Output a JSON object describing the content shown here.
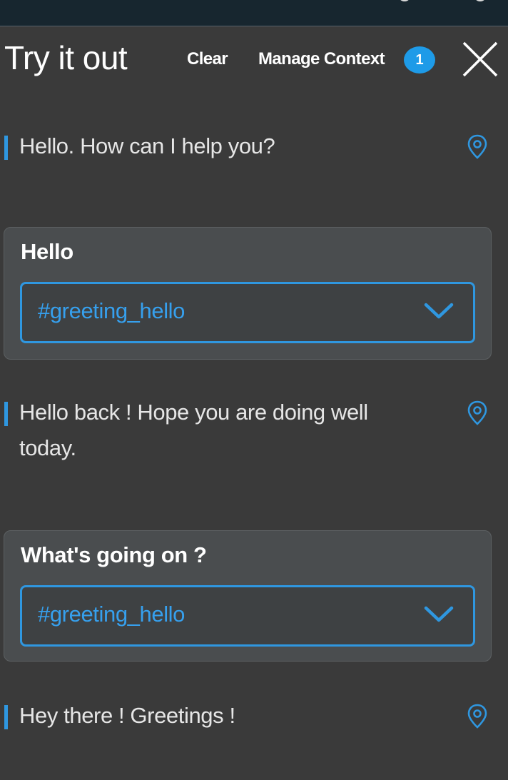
{
  "panel": {
    "title": "Try it out",
    "clear_label": "Clear",
    "manage_context_label": "Manage Context",
    "context_count": "1"
  },
  "conversation": {
    "bot_1": "Hello. How can I help you?",
    "user_1": "Hello",
    "intent_1": "#greeting_hello",
    "bot_2": "Hello back ! Hope you are doing well today.",
    "user_2": "What's going on ?",
    "intent_2": "#greeting_hello",
    "bot_3": "Hey there ! Greetings !"
  },
  "colors": {
    "accent": "#2f97e0",
    "panel_background": "#3a3a3a",
    "card_background": "#4a4d4f",
    "topbar": "#17262f"
  },
  "icons": {
    "close": "close-icon",
    "location": "location-pin-icon",
    "dropdown": "chevron-down-icon"
  }
}
